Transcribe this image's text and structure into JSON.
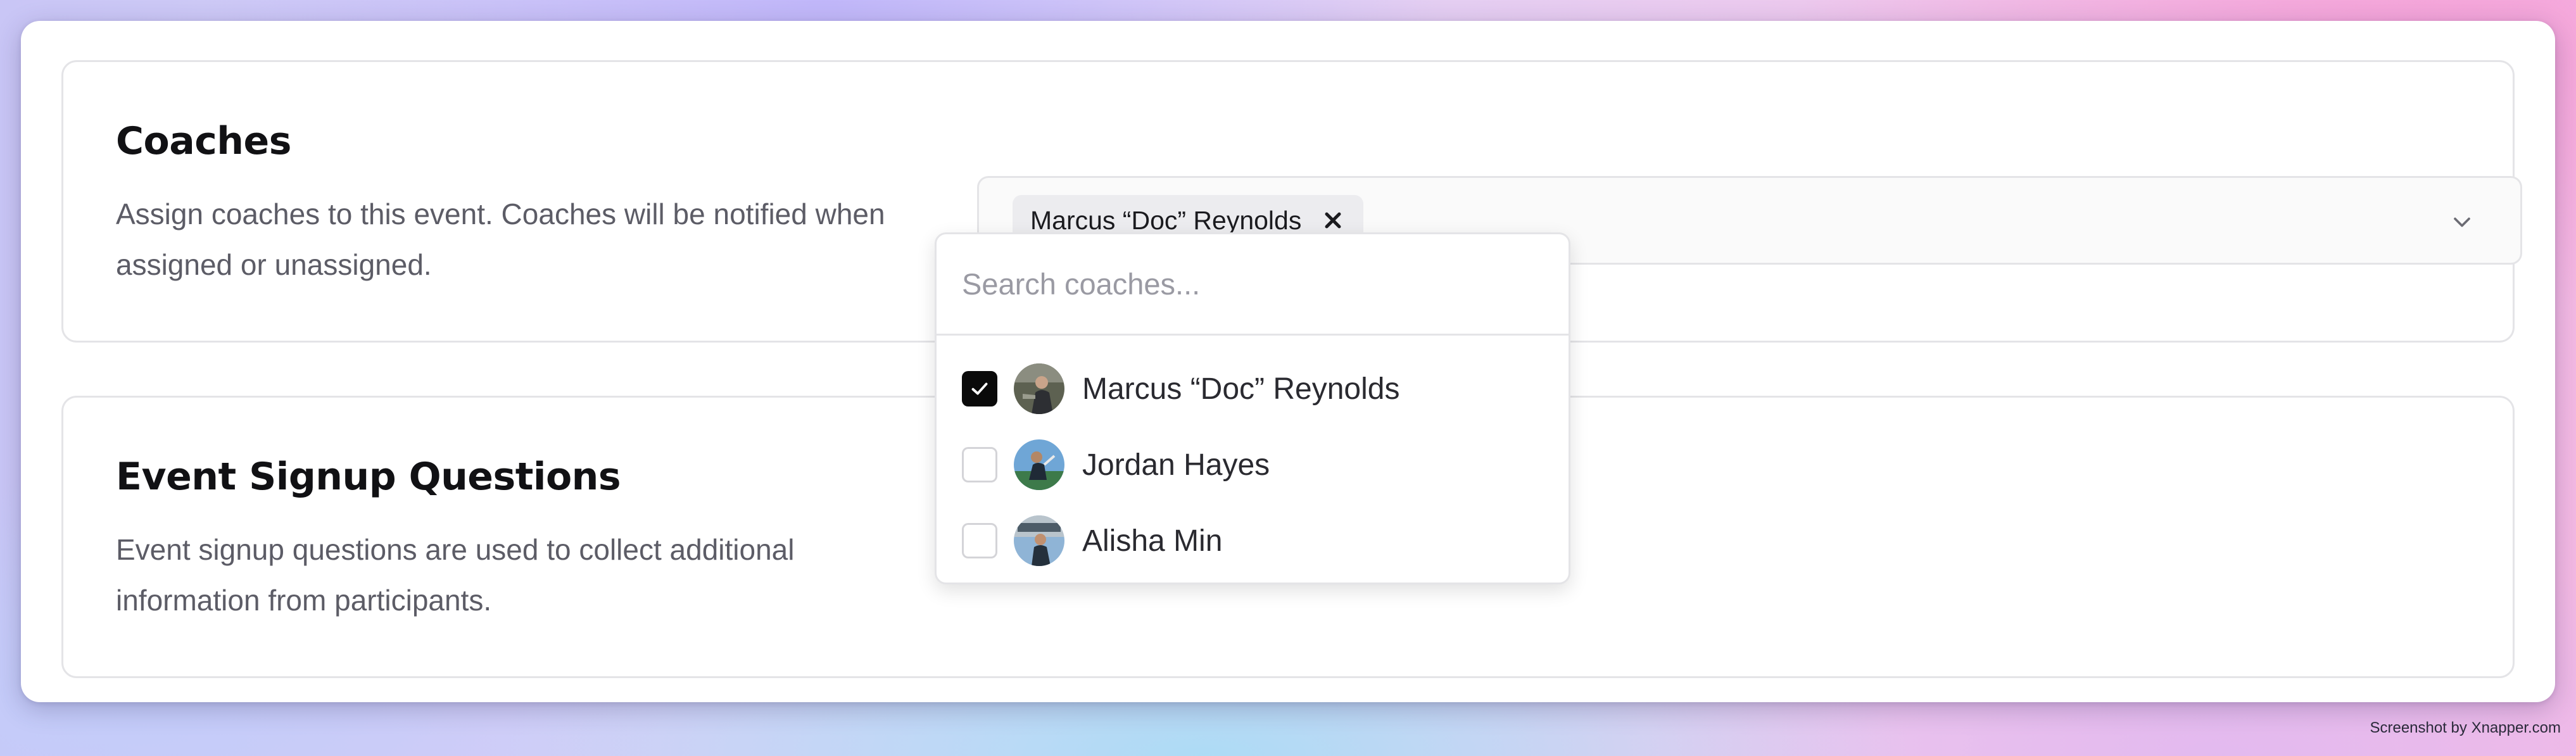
{
  "coaches_section": {
    "title": "Coaches",
    "description": "Assign coaches to this event. Coaches will be notified when assigned or unassigned.",
    "selected_chips": [
      "Marcus “Doc” Reynolds"
    ]
  },
  "dropdown": {
    "search_placeholder": "Search coaches...",
    "search_value": "",
    "options": [
      {
        "label": "Marcus “Doc” Reynolds",
        "checked": true
      },
      {
        "label": "Jordan Hayes",
        "checked": false
      },
      {
        "label": "Alisha Min",
        "checked": false
      }
    ]
  },
  "signup_section": {
    "title": "Event Signup Questions",
    "description": "Event signup questions are used to collect additional information from participants."
  },
  "icons": {
    "chip_remove": "close-icon",
    "combobox_toggle": "chevron-down-icon",
    "checkbox_mark": "check-icon"
  },
  "colors": {
    "checkbox_checked": "#0a0a0a",
    "border": "#e4e4e7",
    "chip_bg": "#ececef"
  },
  "watermark": "Screenshot by Xnapper.com"
}
